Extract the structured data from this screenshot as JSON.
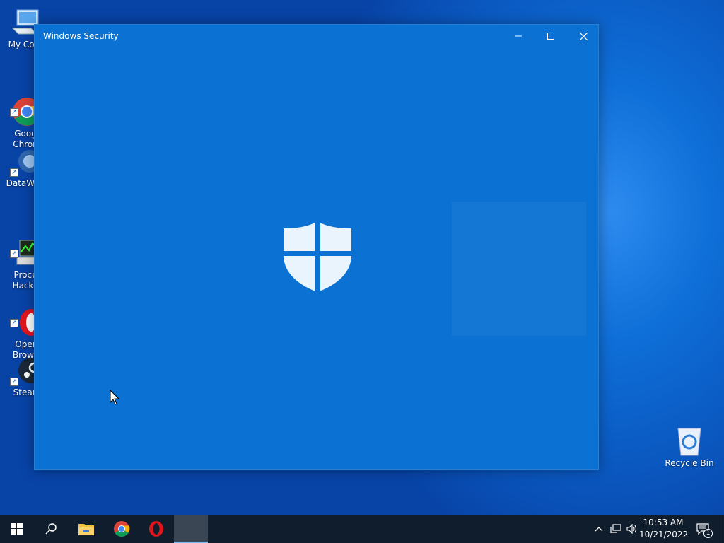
{
  "desktop_icons": [
    {
      "label": "My Com",
      "icon": "computer-icon"
    },
    {
      "label": "Goog\nChron",
      "icon": "chrome-icon"
    },
    {
      "label": "DataWag",
      "icon": "datawag-icon"
    },
    {
      "label": "Proce\nHacke",
      "icon": "process-hacker-icon"
    },
    {
      "label": "Oper\nBrows",
      "icon": "opera-icon"
    },
    {
      "label": "Stean",
      "icon": "steam-icon"
    },
    {
      "label": "Recycle Bin",
      "icon": "recycle-bin-icon"
    }
  ],
  "window": {
    "title": "Windows Security",
    "background": "#0b72d3",
    "splash_icon": "windows-security-shield-icon"
  },
  "taskbar": {
    "items": [
      "start-icon",
      "search-icon",
      "file-explorer-icon",
      "chrome-icon",
      "opera-icon",
      "windows-security-app-icon"
    ],
    "clock": {
      "time": "10:53 AM",
      "date": "10/21/2022"
    },
    "notification_count": "1",
    "tray_icons": [
      "chevron-up-icon",
      "network-icon",
      "volume-icon"
    ]
  },
  "colors": {
    "taskbar": "#101d2c",
    "desktop": "#0a58c0",
    "accent": "#0b72d3"
  }
}
